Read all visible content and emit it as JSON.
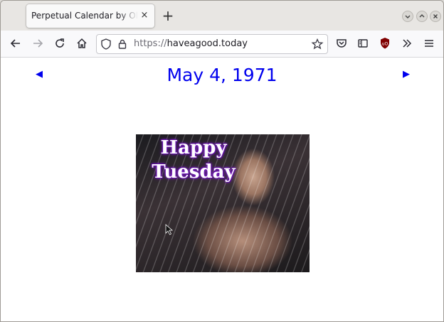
{
  "browser": {
    "tab_title": "Perpetual Calendar by Olia L",
    "tab_close": "×",
    "new_tab": "+",
    "url_scheme": "https://",
    "url_host": "haveagood.today",
    "window_controls": [
      "minimize",
      "maximize",
      "close"
    ]
  },
  "page": {
    "date_title": "May 4, 1971",
    "prev_arrow": "◀",
    "next_arrow": "▶",
    "greeting_line1": "Happy",
    "greeting_line2": "Tuesday"
  }
}
